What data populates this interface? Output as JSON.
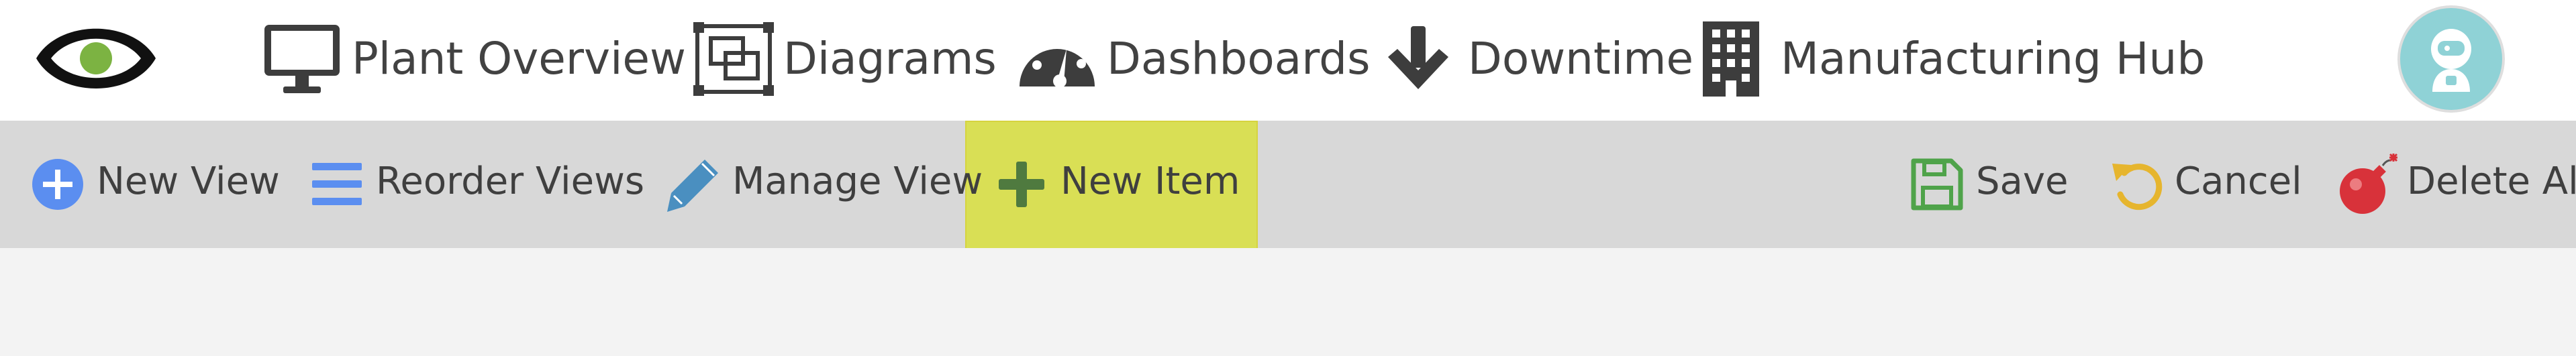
{
  "nav": {
    "logo_icon": "eye-logo-icon",
    "items": [
      {
        "label": "Plant Overview",
        "icon": "monitor-icon"
      },
      {
        "label": "Diagrams",
        "icon": "diagram-frames-icon"
      },
      {
        "label": "Dashboards",
        "icon": "gauge-icon"
      },
      {
        "label": "Downtime",
        "icon": "arrow-down-icon"
      },
      {
        "label": "Manufacturing Hub",
        "icon": "building-icon"
      }
    ],
    "avatar_icon": "astronaut-avatar-icon"
  },
  "toolbar": {
    "left": [
      {
        "label": "New View",
        "icon": "plus-circle-icon",
        "color": "#5b8ef0"
      },
      {
        "label": "Reorder Views",
        "icon": "hamburger-lines-icon",
        "color": "#5b8ef0"
      },
      {
        "label": "Manage View",
        "icon": "pencil-icon",
        "color": "#4a8fc0"
      },
      {
        "label": "New Item",
        "icon": "plus-icon",
        "color": "#4f7a3f",
        "highlighted": true
      }
    ],
    "right": [
      {
        "label": "Save",
        "icon": "floppy-disk-icon",
        "color": "#4fa34a"
      },
      {
        "label": "Cancel",
        "icon": "undo-icon",
        "color": "#e6b52e"
      },
      {
        "label": "Delete All",
        "icon": "bomb-icon",
        "color": "#d8323a"
      }
    ]
  },
  "colors": {
    "topbar_bg": "#ffffff",
    "toolbar_bg": "#d8d8d8",
    "page_bg": "#f3f3f3",
    "highlight": "#d9df55",
    "avatar": "#8fd2d6"
  }
}
